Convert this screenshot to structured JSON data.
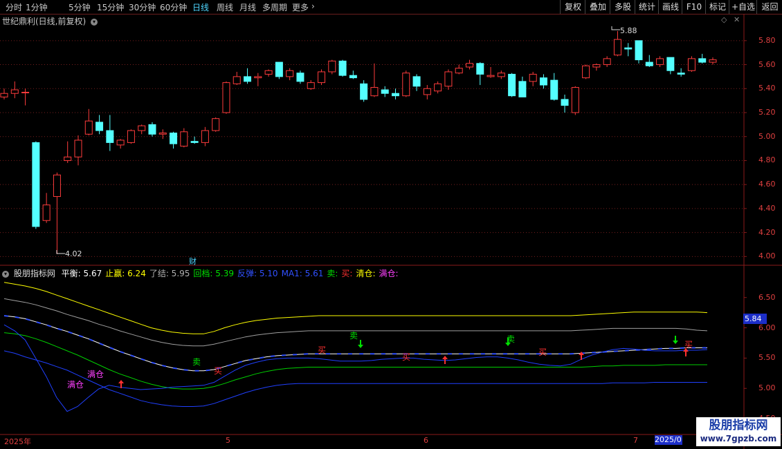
{
  "toolbar": {
    "timeframes": [
      "分时",
      "1分钟",
      "5分钟",
      "15分钟",
      "30分钟",
      "60分钟",
      "日线",
      "周线",
      "月线",
      "多周期",
      "更多"
    ],
    "active_timeframe": "日线",
    "more_arrow": "›",
    "buttons": [
      "复权",
      "叠加",
      "多股",
      "统计",
      "画线",
      "F10",
      "标记",
      "+自选",
      "返回"
    ]
  },
  "main_panel": {
    "title": "世纪鼎利(日线,前复权)",
    "high_label": "5.88",
    "low_label": "4.02",
    "cai_label": "财",
    "y_ticks": [
      "5.80",
      "5.60",
      "5.40",
      "5.20",
      "5.00",
      "4.80",
      "4.60",
      "4.40",
      "4.20",
      "4.00"
    ]
  },
  "indicator_panel": {
    "title": "股朋指标网",
    "items": [
      {
        "label": "平衡:",
        "value": "5.67",
        "color": "#ffffff"
      },
      {
        "label": "止赢:",
        "value": "6.24",
        "color": "#ffff00"
      },
      {
        "label": "了结:",
        "value": "5.95",
        "color": "#b0b0b0"
      },
      {
        "label": "回档:",
        "value": "5.39",
        "color": "#00e000"
      },
      {
        "label": "反弹:",
        "value": "5.10",
        "color": "#3050ff"
      },
      {
        "label": "MA1:",
        "value": "5.61",
        "color": "#3050ff"
      },
      {
        "label": "卖:",
        "value": "",
        "color": "#00e000"
      },
      {
        "label": "买:",
        "value": "",
        "color": "#ff3030"
      },
      {
        "label": "清仓:",
        "value": "",
        "color": "#ffff00"
      },
      {
        "label": "满仓:",
        "value": "",
        "color": "#ff40ff"
      }
    ],
    "y_ticks": [
      "6.50",
      "6.00",
      "5.50",
      "5.00",
      "4.50"
    ],
    "current_value": "5.84",
    "signals": {
      "sell": "卖",
      "buy": "买",
      "full": "满仓"
    }
  },
  "x_axis": {
    "labels": [
      "2025年",
      "5",
      "6",
      "7"
    ],
    "current_date": "2025/0"
  },
  "watermark": {
    "title": "股朋指标网",
    "url": "www.7gpzb.com"
  },
  "colors": {
    "up": "#ff3c3c",
    "down": "#54ffff",
    "grid": "#7a1f1f",
    "border": "#8b1a1a"
  },
  "chart_data": [
    {
      "type": "candlestick",
      "title": "世纪鼎利(日线,前复权)",
      "ylim": [
        3.95,
        5.92
      ],
      "y_ticks": [
        5.8,
        5.6,
        5.4,
        5.2,
        5.0,
        4.8,
        4.6,
        4.4,
        4.2,
        4.0
      ],
      "candles": [
        {
          "o": 5.33,
          "h": 5.4,
          "l": 5.31,
          "c": 5.36
        },
        {
          "o": 5.36,
          "h": 5.46,
          "l": 5.32,
          "c": 5.39
        },
        {
          "o": 5.37,
          "h": 5.4,
          "l": 5.26,
          "c": 5.37
        },
        {
          "o": 4.95,
          "h": 4.96,
          "l": 4.23,
          "c": 4.25
        },
        {
          "o": 4.3,
          "h": 4.53,
          "l": 4.28,
          "c": 4.43
        },
        {
          "o": 4.5,
          "h": 4.7,
          "l": 4.02,
          "c": 4.68
        },
        {
          "o": 4.8,
          "h": 4.96,
          "l": 4.78,
          "c": 4.83
        },
        {
          "o": 4.83,
          "h": 5.01,
          "l": 4.76,
          "c": 4.97
        },
        {
          "o": 5.02,
          "h": 5.23,
          "l": 5.01,
          "c": 5.13
        },
        {
          "o": 5.12,
          "h": 5.18,
          "l": 5.02,
          "c": 5.05
        },
        {
          "o": 5.05,
          "h": 5.18,
          "l": 4.88,
          "c": 4.95
        },
        {
          "o": 4.93,
          "h": 4.98,
          "l": 4.9,
          "c": 4.97
        },
        {
          "o": 4.95,
          "h": 5.06,
          "l": 4.94,
          "c": 5.05
        },
        {
          "o": 5.05,
          "h": 5.1,
          "l": 5.02,
          "c": 5.09
        },
        {
          "o": 5.1,
          "h": 5.12,
          "l": 5.0,
          "c": 5.02
        },
        {
          "o": 5.02,
          "h": 5.06,
          "l": 4.98,
          "c": 5.03
        },
        {
          "o": 5.03,
          "h": 5.04,
          "l": 4.9,
          "c": 4.94
        },
        {
          "o": 4.92,
          "h": 5.07,
          "l": 4.91,
          "c": 5.04
        },
        {
          "o": 4.96,
          "h": 5.0,
          "l": 4.94,
          "c": 4.95
        },
        {
          "o": 4.95,
          "h": 5.08,
          "l": 4.92,
          "c": 5.05
        },
        {
          "o": 5.05,
          "h": 5.16,
          "l": 5.04,
          "c": 5.15
        },
        {
          "o": 5.2,
          "h": 5.46,
          "l": 5.19,
          "c": 5.45
        },
        {
          "o": 5.44,
          "h": 5.54,
          "l": 5.43,
          "c": 5.5
        },
        {
          "o": 5.5,
          "h": 5.57,
          "l": 5.44,
          "c": 5.46
        },
        {
          "o": 5.49,
          "h": 5.53,
          "l": 5.42,
          "c": 5.5
        },
        {
          "o": 5.52,
          "h": 5.56,
          "l": 5.5,
          "c": 5.55
        },
        {
          "o": 5.62,
          "h": 5.62,
          "l": 5.48,
          "c": 5.5
        },
        {
          "o": 5.5,
          "h": 5.57,
          "l": 5.47,
          "c": 5.55
        },
        {
          "o": 5.53,
          "h": 5.55,
          "l": 5.44,
          "c": 5.46
        },
        {
          "o": 5.4,
          "h": 5.47,
          "l": 5.39,
          "c": 5.45
        },
        {
          "o": 5.45,
          "h": 5.56,
          "l": 5.43,
          "c": 5.54
        },
        {
          "o": 5.54,
          "h": 5.64,
          "l": 5.52,
          "c": 5.63
        },
        {
          "o": 5.63,
          "h": 5.64,
          "l": 5.5,
          "c": 5.51
        },
        {
          "o": 5.51,
          "h": 5.55,
          "l": 5.48,
          "c": 5.49
        },
        {
          "o": 5.44,
          "h": 5.47,
          "l": 5.29,
          "c": 5.31
        },
        {
          "o": 5.34,
          "h": 5.61,
          "l": 5.33,
          "c": 5.41
        },
        {
          "o": 5.39,
          "h": 5.42,
          "l": 5.33,
          "c": 5.36
        },
        {
          "o": 5.36,
          "h": 5.4,
          "l": 5.31,
          "c": 5.34
        },
        {
          "o": 5.34,
          "h": 5.55,
          "l": 5.33,
          "c": 5.53
        },
        {
          "o": 5.5,
          "h": 5.52,
          "l": 5.38,
          "c": 5.42
        },
        {
          "o": 5.35,
          "h": 5.43,
          "l": 5.31,
          "c": 5.4
        },
        {
          "o": 5.38,
          "h": 5.46,
          "l": 5.36,
          "c": 5.44
        },
        {
          "o": 5.42,
          "h": 5.56,
          "l": 5.39,
          "c": 5.54
        },
        {
          "o": 5.53,
          "h": 5.6,
          "l": 5.52,
          "c": 5.57
        },
        {
          "o": 5.58,
          "h": 5.64,
          "l": 5.56,
          "c": 5.61
        },
        {
          "o": 5.61,
          "h": 5.62,
          "l": 5.43,
          "c": 5.52
        },
        {
          "o": 5.5,
          "h": 5.58,
          "l": 5.49,
          "c": 5.51
        },
        {
          "o": 5.5,
          "h": 5.55,
          "l": 5.48,
          "c": 5.53
        },
        {
          "o": 5.52,
          "h": 5.53,
          "l": 5.33,
          "c": 5.34
        },
        {
          "o": 5.46,
          "h": 5.5,
          "l": 5.33,
          "c": 5.33
        },
        {
          "o": 5.46,
          "h": 5.54,
          "l": 5.42,
          "c": 5.52
        },
        {
          "o": 5.49,
          "h": 5.52,
          "l": 5.4,
          "c": 5.43
        },
        {
          "o": 5.47,
          "h": 5.53,
          "l": 5.3,
          "c": 5.31
        },
        {
          "o": 5.31,
          "h": 5.35,
          "l": 5.2,
          "c": 5.26
        },
        {
          "o": 5.2,
          "h": 5.42,
          "l": 5.18,
          "c": 5.41
        },
        {
          "o": 5.49,
          "h": 5.6,
          "l": 5.48,
          "c": 5.59
        },
        {
          "o": 5.58,
          "h": 5.61,
          "l": 5.55,
          "c": 5.6
        },
        {
          "o": 5.6,
          "h": 5.67,
          "l": 5.58,
          "c": 5.65
        },
        {
          "o": 5.68,
          "h": 5.88,
          "l": 5.67,
          "c": 5.81
        },
        {
          "o": 5.74,
          "h": 5.78,
          "l": 5.67,
          "c": 5.73
        },
        {
          "o": 5.8,
          "h": 5.8,
          "l": 5.61,
          "c": 5.64
        },
        {
          "o": 5.62,
          "h": 5.68,
          "l": 5.58,
          "c": 5.59
        },
        {
          "o": 5.6,
          "h": 5.67,
          "l": 5.58,
          "c": 5.65
        },
        {
          "o": 5.66,
          "h": 5.66,
          "l": 5.52,
          "c": 5.55
        },
        {
          "o": 5.53,
          "h": 5.57,
          "l": 5.5,
          "c": 5.52
        },
        {
          "o": 5.55,
          "h": 5.67,
          "l": 5.54,
          "c": 5.65
        },
        {
          "o": 5.65,
          "h": 5.69,
          "l": 5.61,
          "c": 5.62
        },
        {
          "o": 5.62,
          "h": 5.66,
          "l": 5.6,
          "c": 5.64
        }
      ]
    },
    {
      "type": "line",
      "title": "股朋指标网",
      "ylim": [
        4.25,
        6.85
      ],
      "y_ticks": [
        6.5,
        6.0,
        5.5,
        5.0,
        4.5
      ],
      "x": [
        0,
        1,
        2,
        3,
        4,
        5,
        6,
        7,
        8,
        9,
        10,
        11,
        12,
        13,
        14,
        15,
        16,
        17,
        18,
        19,
        20,
        21,
        22,
        23,
        24,
        25,
        26,
        27,
        28,
        29,
        30,
        31,
        32,
        33,
        34,
        35,
        36,
        37,
        38,
        39,
        40,
        41,
        42,
        43,
        44,
        45,
        46,
        47,
        48,
        49,
        50,
        51,
        52,
        53,
        54,
        55,
        56,
        57,
        58,
        59,
        60,
        61,
        62,
        63,
        64,
        65,
        66,
        67
      ],
      "series": [
        {
          "name": "止赢",
          "color": "#ffff00",
          "values": [
            6.75,
            6.72,
            6.69,
            6.65,
            6.6,
            6.54,
            6.48,
            6.42,
            6.36,
            6.3,
            6.24,
            6.18,
            6.12,
            6.06,
            6.0,
            5.96,
            5.93,
            5.91,
            5.9,
            5.9,
            5.94,
            6.0,
            6.05,
            6.09,
            6.12,
            6.14,
            6.16,
            6.17,
            6.18,
            6.19,
            6.2,
            6.2,
            6.2,
            6.2,
            6.2,
            6.2,
            6.2,
            6.2,
            6.2,
            6.2,
            6.2,
            6.2,
            6.2,
            6.2,
            6.2,
            6.2,
            6.2,
            6.2,
            6.2,
            6.2,
            6.2,
            6.2,
            6.2,
            6.2,
            6.2,
            6.21,
            6.22,
            6.23,
            6.24,
            6.25,
            6.26,
            6.26,
            6.26,
            6.26,
            6.26,
            6.26,
            6.26,
            6.25
          ]
        },
        {
          "name": "了结",
          "color": "#a0a0a0",
          "values": [
            6.48,
            6.45,
            6.42,
            6.38,
            6.33,
            6.28,
            6.22,
            6.17,
            6.12,
            6.06,
            6.01,
            5.95,
            5.9,
            5.85,
            5.8,
            5.76,
            5.73,
            5.71,
            5.7,
            5.7,
            5.73,
            5.77,
            5.81,
            5.85,
            5.88,
            5.9,
            5.92,
            5.93,
            5.94,
            5.95,
            5.95,
            5.95,
            5.95,
            5.95,
            5.95,
            5.95,
            5.95,
            5.95,
            5.95,
            5.95,
            5.95,
            5.95,
            5.95,
            5.95,
            5.95,
            5.95,
            5.95,
            5.95,
            5.95,
            5.95,
            5.95,
            5.95,
            5.95,
            5.95,
            5.95,
            5.96,
            5.97,
            5.98,
            5.99,
            5.99,
            5.99,
            5.99,
            5.99,
            5.99,
            5.99,
            5.98,
            5.96,
            5.95
          ]
        },
        {
          "name": "平衡",
          "color": "#ffffff",
          "values": [
            6.2,
            6.18,
            6.15,
            6.1,
            6.05,
            5.99,
            5.94,
            5.88,
            5.82,
            5.75,
            5.68,
            5.61,
            5.55,
            5.49,
            5.43,
            5.38,
            5.34,
            5.31,
            5.29,
            5.29,
            5.31,
            5.36,
            5.41,
            5.46,
            5.49,
            5.52,
            5.54,
            5.55,
            5.56,
            5.57,
            5.57,
            5.57,
            5.57,
            5.57,
            5.57,
            5.57,
            5.57,
            5.57,
            5.57,
            5.57,
            5.57,
            5.57,
            5.57,
            5.57,
            5.57,
            5.57,
            5.57,
            5.57,
            5.57,
            5.57,
            5.57,
            5.57,
            5.57,
            5.57,
            5.57,
            5.58,
            5.59,
            5.6,
            5.61,
            5.62,
            5.63,
            5.64,
            5.65,
            5.66,
            5.66,
            5.67,
            5.67,
            5.67
          ]
        },
        {
          "name": "回档",
          "color": "#00d000",
          "values": [
            5.92,
            5.9,
            5.87,
            5.82,
            5.76,
            5.69,
            5.62,
            5.55,
            5.47,
            5.39,
            5.31,
            5.24,
            5.18,
            5.12,
            5.07,
            5.03,
            5.0,
            4.99,
            4.99,
            5.0,
            5.03,
            5.08,
            5.14,
            5.19,
            5.24,
            5.28,
            5.31,
            5.33,
            5.34,
            5.35,
            5.35,
            5.35,
            5.35,
            5.35,
            5.35,
            5.35,
            5.35,
            5.35,
            5.35,
            5.35,
            5.35,
            5.35,
            5.35,
            5.35,
            5.35,
            5.35,
            5.35,
            5.35,
            5.35,
            5.35,
            5.35,
            5.35,
            5.35,
            5.35,
            5.35,
            5.35,
            5.36,
            5.37,
            5.37,
            5.38,
            5.38,
            5.38,
            5.38,
            5.39,
            5.39,
            5.39,
            5.39,
            5.39
          ]
        },
        {
          "name": "反弹",
          "color": "#2040ff",
          "values": [
            5.62,
            5.58,
            5.52,
            5.47,
            5.42,
            5.36,
            5.3,
            5.22,
            5.14,
            5.06,
            4.98,
            4.92,
            4.86,
            4.8,
            4.76,
            4.73,
            4.71,
            4.7,
            4.7,
            4.71,
            4.75,
            4.81,
            4.87,
            4.93,
            4.98,
            5.02,
            5.05,
            5.07,
            5.08,
            5.08,
            5.08,
            5.08,
            5.08,
            5.08,
            5.08,
            5.08,
            5.08,
            5.08,
            5.08,
            5.08,
            5.08,
            5.08,
            5.08,
            5.08,
            5.08,
            5.08,
            5.08,
            5.08,
            5.08,
            5.08,
            5.08,
            5.08,
            5.08,
            5.08,
            5.08,
            5.08,
            5.08,
            5.08,
            5.09,
            5.09,
            5.09,
            5.09,
            5.1,
            5.1,
            5.1,
            5.1,
            5.1,
            5.1
          ]
        },
        {
          "name": "MA1",
          "color": "#2040ff",
          "values": [
            6.05,
            5.95,
            5.8,
            5.5,
            5.2,
            4.85,
            4.62,
            4.7,
            4.85,
            4.99,
            5.05,
            5.02,
            5.0,
            4.98,
            4.99,
            5.0,
            5.02,
            5.03,
            5.04,
            5.05,
            5.1,
            5.2,
            5.3,
            5.38,
            5.43,
            5.47,
            5.49,
            5.5,
            5.5,
            5.5,
            5.49,
            5.47,
            5.45,
            5.45,
            5.45,
            5.46,
            5.48,
            5.49,
            5.5,
            5.5,
            5.48,
            5.47,
            5.46,
            5.47,
            5.49,
            5.51,
            5.52,
            5.52,
            5.5,
            5.47,
            5.43,
            5.4,
            5.38,
            5.37,
            5.4,
            5.48,
            5.55,
            5.6,
            5.64,
            5.66,
            5.65,
            5.63,
            5.62,
            5.62,
            5.62,
            5.63,
            5.63,
            5.64
          ]
        }
      ]
    }
  ]
}
